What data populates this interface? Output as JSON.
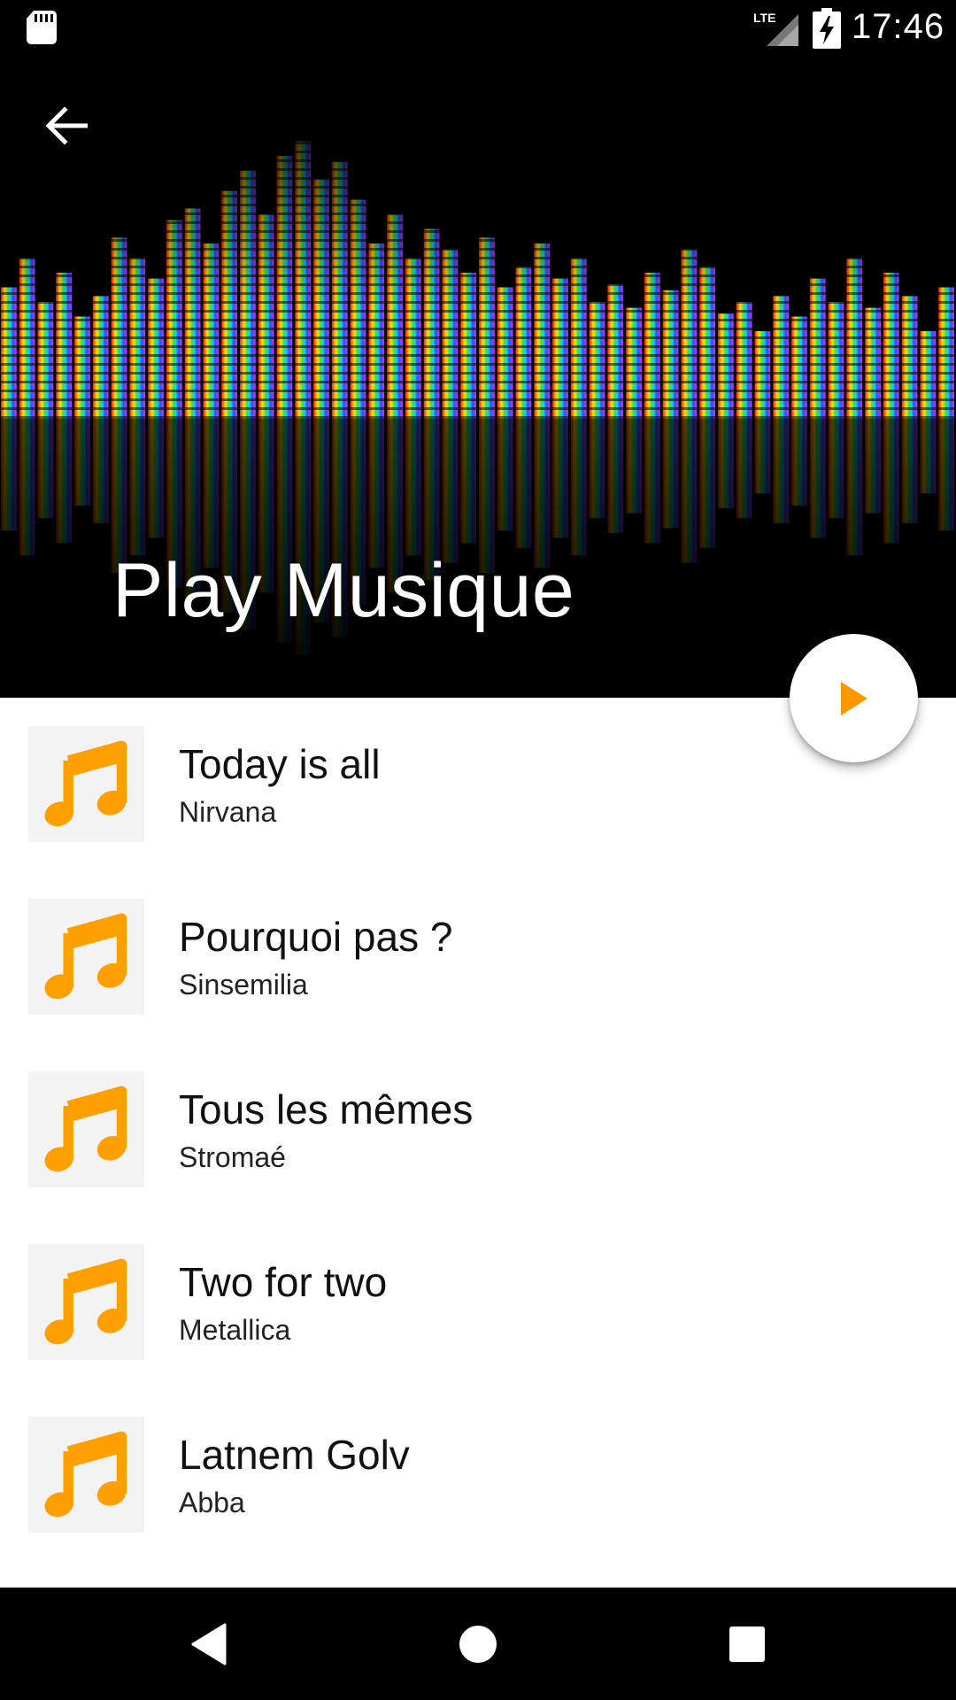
{
  "status_bar": {
    "time": "17:46",
    "network_label": "LTE",
    "icons": [
      "sd-card-icon",
      "lte-signal-icon",
      "battery-charging-icon"
    ]
  },
  "header": {
    "title": "Play Musique",
    "back_icon": "arrow-back-icon"
  },
  "fab": {
    "icon": "play-icon",
    "color": "#FF9800"
  },
  "songs": [
    {
      "title": "Today is all",
      "artist": "Nirvana",
      "icon": "music-note-icon"
    },
    {
      "title": "Pourquoi pas ?",
      "artist": "Sinsemilia",
      "icon": "music-note-icon"
    },
    {
      "title": "Tous les mêmes",
      "artist": "Stromaé",
      "icon": "music-note-icon"
    },
    {
      "title": "Two for two",
      "artist": "Metallica",
      "icon": "music-note-icon"
    },
    {
      "title": "Latnem Golv",
      "artist": "Abba",
      "icon": "music-note-icon"
    }
  ],
  "nav_bar": {
    "icons": [
      "back-triangle-icon",
      "home-circle-icon",
      "recents-square-icon"
    ]
  },
  "colors": {
    "accent": "#FFA000",
    "header_bg": "#000000",
    "list_bg": "#FFFFFF",
    "thumb_bg": "#F3F3F3"
  }
}
